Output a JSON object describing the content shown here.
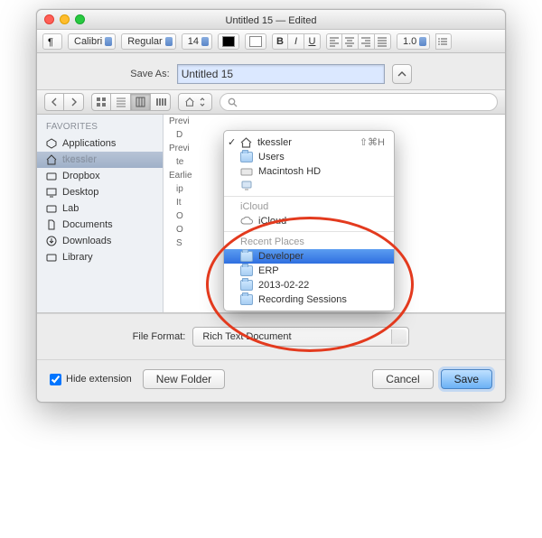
{
  "window": {
    "title_main": "Untitled 15",
    "title_suffix": " — Edited"
  },
  "toolbar": {
    "font_family": "Calibri",
    "font_style": "Regular",
    "font_size": "14",
    "line_spacing": "1.0"
  },
  "save": {
    "label": "Save As:",
    "filename": "Untitled 15"
  },
  "search": {
    "placeholder": "Q"
  },
  "sidebar": {
    "header": "FAVORITES",
    "items": [
      {
        "label": "Applications"
      },
      {
        "label": "tkessler"
      },
      {
        "label": "Dropbox"
      },
      {
        "label": "Desktop"
      },
      {
        "label": "Lab"
      },
      {
        "label": "Documents"
      },
      {
        "label": "Downloads"
      },
      {
        "label": "Library"
      }
    ]
  },
  "column": {
    "groups": [
      "Previ",
      "Previ",
      "Earlie"
    ],
    "rows": [
      "D",
      "te",
      "ip",
      "It",
      "O",
      "O",
      "S"
    ]
  },
  "menu": {
    "top": [
      {
        "label": "tkessler",
        "shortcut": "⇧⌘H",
        "checked": true
      },
      {
        "label": "Users"
      },
      {
        "label": "Macintosh HD"
      },
      {
        "label": ""
      }
    ],
    "icloud_hdr": "iCloud",
    "icloud_item": "iCloud",
    "recent_hdr": "Recent Places",
    "recent": [
      {
        "label": "Developer",
        "selected": true
      },
      {
        "label": "ERP"
      },
      {
        "label": "2013-02-22"
      },
      {
        "label": "Recording Sessions"
      }
    ]
  },
  "file_format": {
    "label": "File Format:",
    "value": "Rich Text Document"
  },
  "footer": {
    "hide_ext": "Hide extension",
    "new_folder": "New Folder",
    "cancel": "Cancel",
    "save": "Save"
  },
  "annotation": {
    "note": "red oval highlights Recent Places section"
  }
}
